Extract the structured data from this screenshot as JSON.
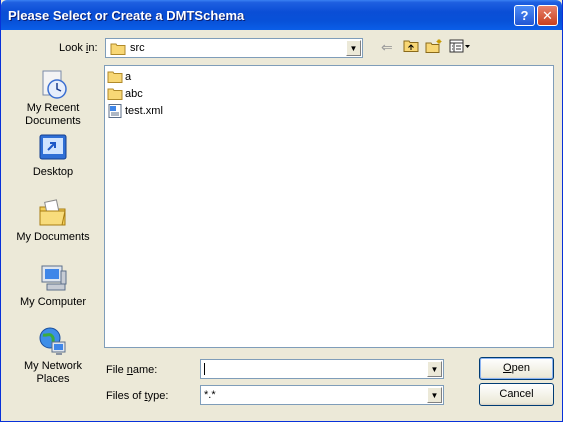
{
  "window": {
    "title": "Please Select or Create a DMTSchema",
    "help_glyph": "?",
    "close_glyph": "✕"
  },
  "toolbar": {
    "look_in_label_pre": "Look ",
    "look_in_label_u": "i",
    "look_in_label_post": "n:",
    "look_in_value": "src",
    "icons": [
      "back-icon",
      "up-folder-icon",
      "new-folder-icon",
      "view-menu-icon"
    ]
  },
  "places": [
    {
      "name": "my-recent-documents",
      "label": "My Recent Documents",
      "icon": "recent-documents-icon"
    },
    {
      "name": "desktop",
      "label": "Desktop",
      "icon": "desktop-icon"
    },
    {
      "name": "my-documents",
      "label": "My Documents",
      "icon": "my-documents-icon"
    },
    {
      "name": "my-computer",
      "label": "My Computer",
      "icon": "my-computer-icon"
    },
    {
      "name": "my-network-places",
      "label": "My Network Places",
      "icon": "network-places-icon"
    }
  ],
  "files": [
    {
      "name": "a",
      "type": "folder"
    },
    {
      "name": "abc",
      "type": "folder"
    },
    {
      "name": "test.xml",
      "type": "xml"
    }
  ],
  "form": {
    "file_name_pre": "File ",
    "file_name_u": "n",
    "file_name_post": "ame:",
    "file_name_value": "",
    "files_of_type_pre": "Files of ",
    "files_of_type_u": "t",
    "files_of_type_post": "ype:",
    "files_of_type_value": "*.*"
  },
  "buttons": {
    "open_u": "O",
    "open_rest": "pen",
    "cancel": "Cancel"
  },
  "colors": {
    "titlebar": "#0a4ed6",
    "dialog_bg": "#ece9d8",
    "field_border": "#7f9db9"
  }
}
